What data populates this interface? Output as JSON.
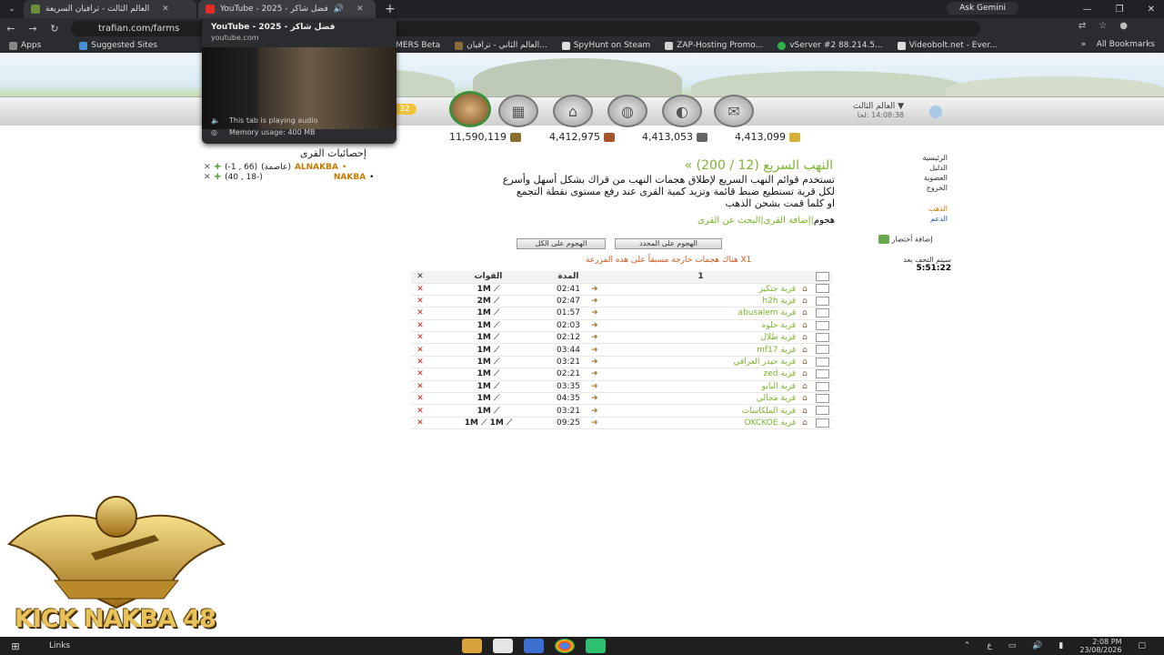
{
  "browser": {
    "tabs": [
      {
        "title": "العالم الثالث - ترافيان السريعة",
        "active": false
      },
      {
        "title": "YouTube - 2025 - فضل شاكر",
        "active": true
      }
    ],
    "ask_gemini": "Ask Gemini",
    "url": "trafian.com/farms",
    "bookmarks": [
      "Apps",
      "Suggested Sites",
      "AMERS Beta",
      "العالم الثاني - ترافيان...",
      "SpyHunt on Steam",
      "ZAP-Hosting Promo...",
      "vServer #2 88.214.5...",
      "Videobolt.net - Ever..."
    ],
    "all_bookmarks": "All Bookmarks",
    "hovercard": {
      "title": "YouTube - 2025 - فضل شاكر",
      "domain": "youtube.com",
      "audio": "This tab is playing audio",
      "memory": "Memory usage: 400 MB"
    }
  },
  "game": {
    "server_name": "العالم الثالث",
    "server_time": "14:08:38 :لحا",
    "gold_count": "32",
    "resources": [
      "11,590,119",
      "4,412,975",
      "4,413,053",
      "4,413,099"
    ],
    "stats_title": "إحصائيات القرى",
    "villages": [
      {
        "name": "ALNAKBA",
        "tag": "(عاصمة)",
        "coords": "(-1 , 66)"
      },
      {
        "name": "NAKBA",
        "tag": "",
        "coords": "(40 , 18-)"
      }
    ],
    "sidebar": {
      "links": [
        "الرئيسية",
        "الدليل",
        "العضوية",
        "الخروج"
      ],
      "gold": "الذهب",
      "plus": "الدعم",
      "add_shortcut": "إضافة أختصار",
      "timer_label": "سيتم التحف بعد",
      "timer_value": "5:51:22"
    },
    "main": {
      "title": "النهب السريع (12 / 200) »",
      "desc_1": "تستخدم قوائم النهب السريع لإطلاق هجمات النهب من قراك بشكل أسهل وأسرع",
      "desc_2": "لكل قرية تستطيع ضبط قائمة وتزيد كمية القرى عند رفع مستوى نقطة التجمع",
      "desc_3": "او كلما قمت بشحن الذهب",
      "link_attack": "هجوم",
      "link_add": "إضافة القرى",
      "link_search": "البحث عن القرى",
      "btn_attack_selected": "الهجوم على المحدد",
      "btn_attack_all": "الهجوم على الكل",
      "warning": "X1 هناك هجمات خارجة مسبقاً على هذه المزرعة",
      "col_num": "1",
      "col_time": "المدة",
      "col_troops": "القوات"
    },
    "rows": [
      {
        "village": "قرية جنكيز",
        "time": "02:41",
        "troops": "1M"
      },
      {
        "village": "قرية h2h",
        "time": "02:47",
        "troops": "2M"
      },
      {
        "village": "قرية abusalem",
        "time": "01:57",
        "troops": "1M"
      },
      {
        "village": "قرية حلوه",
        "time": "02:03",
        "troops": "1M"
      },
      {
        "village": "قرية طلال",
        "time": "02:12",
        "troops": "1M"
      },
      {
        "village": "قرية mf17",
        "time": "03:44",
        "troops": "1M"
      },
      {
        "village": "قرية حيدر العراقي",
        "time": "03:21",
        "troops": "1M"
      },
      {
        "village": "قرية zed",
        "time": "02:21",
        "troops": "1M"
      },
      {
        "village": "قرية البابو",
        "time": "03:35",
        "troops": "1M"
      },
      {
        "village": "قرية مجالي",
        "time": "04:35",
        "troops": "1M"
      },
      {
        "village": "قرية الملكاسات",
        "time": "03:21",
        "troops": "1M"
      },
      {
        "village": "قرية OKCKOE",
        "time": "09:25",
        "troops": "1M",
        "troops_extra": "1M"
      }
    ]
  },
  "logo_text": "KICK NAKBA 48",
  "taskbar": {
    "links": "Links",
    "time": "2:08 PM",
    "date": "23/08/2026",
    "lang": "ع"
  }
}
